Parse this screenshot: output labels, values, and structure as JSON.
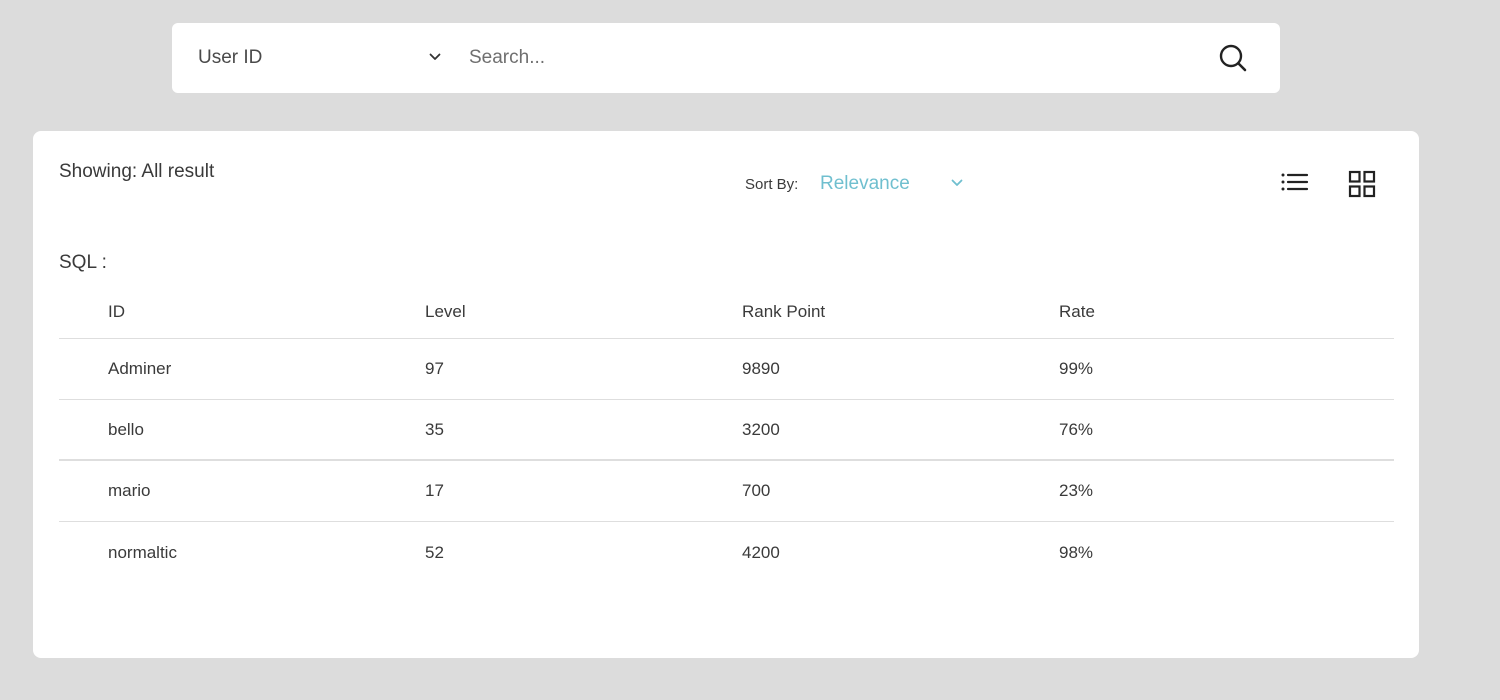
{
  "search": {
    "field_selected": "User ID",
    "placeholder": "Search...",
    "value": ""
  },
  "results": {
    "showing_label": "Showing: All result",
    "sort": {
      "label": "Sort By:",
      "selected": "Relevance"
    },
    "view_modes": [
      {
        "icon": "list-icon",
        "active": false
      },
      {
        "icon": "grid-icon",
        "active": false
      }
    ],
    "section_label": "SQL :",
    "table": {
      "columns": [
        "ID",
        "Level",
        "Rank Point",
        "Rate"
      ],
      "rows": [
        [
          "Adminer",
          "97",
          "9890",
          "99%"
        ],
        [
          "bello",
          "35",
          "3200",
          "76%"
        ],
        [
          "mario",
          "17",
          "700",
          "23%"
        ],
        [
          "normaltic",
          "52",
          "4200",
          "98%"
        ]
      ]
    }
  },
  "colors": {
    "page_background": "#dcdcdc",
    "card_background": "#ffffff",
    "accent": "#6fbfcf",
    "text": "#3a3a3a",
    "divider": "#dedede"
  }
}
